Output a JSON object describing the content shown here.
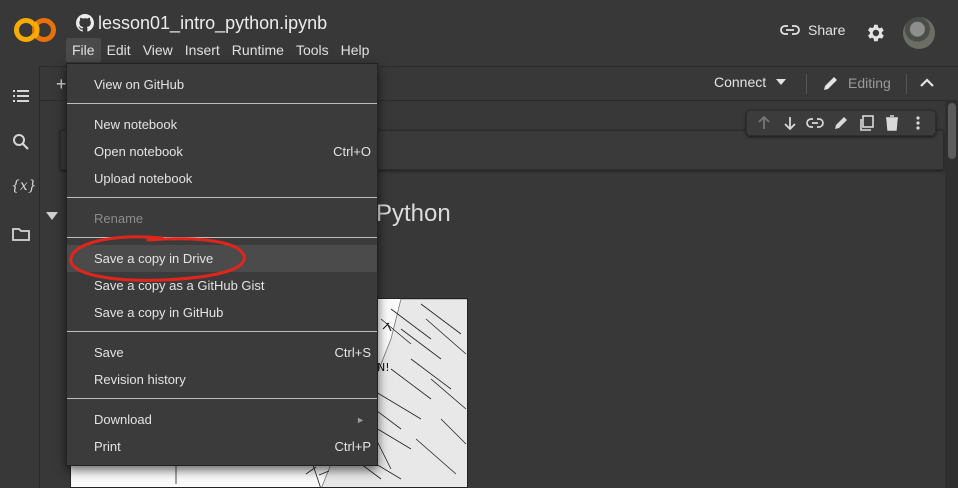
{
  "app": {
    "logo_text": "CO",
    "notebook_title": "lesson01_intro_python.ipynb",
    "github_icon": "github-icon"
  },
  "menubar": {
    "items": [
      "File",
      "Edit",
      "View",
      "Insert",
      "Runtime",
      "Tools",
      "Help"
    ],
    "active": "File"
  },
  "header": {
    "share_label": "Share",
    "share_icon": "link-icon",
    "settings_icon": "gear-icon",
    "avatar_icon": "user-avatar"
  },
  "sidebar": {
    "icons": [
      "table-of-contents-icon",
      "search-icon",
      "variables-icon",
      "folder-icon"
    ],
    "variables_label": "{x}"
  },
  "toolbar": {
    "add_label": "+",
    "connect_label": "Connect",
    "editing_label": "Editing"
  },
  "cell_toolbar": {
    "icons": [
      "move-up-icon",
      "move-down-icon",
      "link-icon",
      "edit-icon",
      "mirror-cell-icon",
      "delete-icon",
      "more-icon"
    ]
  },
  "notebook": {
    "heading_fragment": "Python",
    "comic_texts": [
      "N!"
    ]
  },
  "file_menu": {
    "items": [
      {
        "label": "View on GitHub",
        "shortcut": ""
      },
      {
        "label": "New notebook",
        "shortcut": ""
      },
      {
        "label": "Open notebook",
        "shortcut": "Ctrl+O"
      },
      {
        "label": "Upload notebook",
        "shortcut": ""
      },
      {
        "label": "Rename",
        "shortcut": "",
        "disabled": true
      },
      {
        "label": "Save a copy in Drive",
        "shortcut": "",
        "highlighted": true
      },
      {
        "label": "Save a copy as a GitHub Gist",
        "shortcut": ""
      },
      {
        "label": "Save a copy in GitHub",
        "shortcut": ""
      },
      {
        "label": "Save",
        "shortcut": "Ctrl+S"
      },
      {
        "label": "Revision history",
        "shortcut": ""
      },
      {
        "label": "Download",
        "shortcut": "",
        "submenu": true
      },
      {
        "label": "Print",
        "shortcut": "Ctrl+P"
      }
    ]
  },
  "colors": {
    "background": "#383838",
    "logo_orange": "#f9ab00",
    "logo_dark_orange": "#e8710a",
    "annotation_red": "#e0261c"
  }
}
